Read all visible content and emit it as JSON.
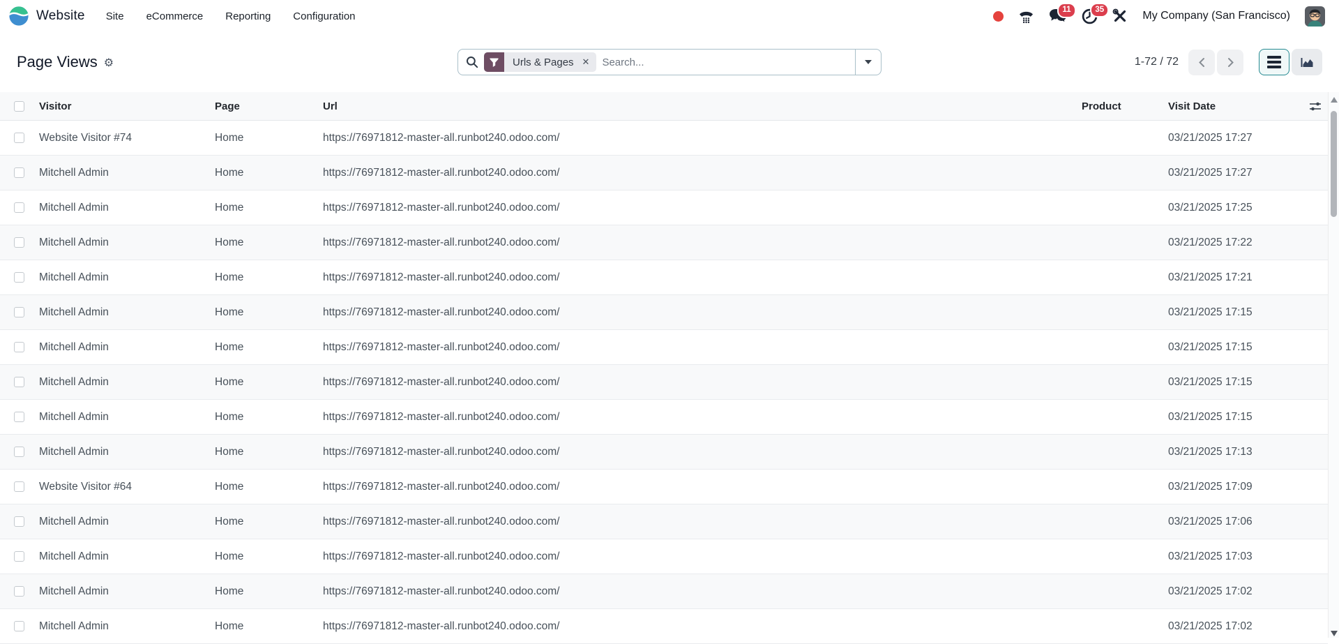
{
  "navbar": {
    "app_name": "Website",
    "menu_items": [
      "Site",
      "eCommerce",
      "Reporting",
      "Configuration"
    ],
    "message_badge": "11",
    "activity_badge": "35",
    "company": "My Company (San Francisco)"
  },
  "control_panel": {
    "title": "Page Views",
    "search": {
      "facet_label": "Urls & Pages",
      "placeholder": "Search..."
    },
    "pager": {
      "value": "1-72 / 72"
    }
  },
  "table": {
    "columns": [
      "Visitor",
      "Page",
      "Url",
      "Product",
      "Visit Date"
    ],
    "rows": [
      {
        "visitor": "Website Visitor #74",
        "page": "Home",
        "url": "https://76971812-master-all.runbot240.odoo.com/",
        "product": "",
        "visit_date": "03/21/2025 17:27"
      },
      {
        "visitor": "Mitchell Admin",
        "page": "Home",
        "url": "https://76971812-master-all.runbot240.odoo.com/",
        "product": "",
        "visit_date": "03/21/2025 17:27"
      },
      {
        "visitor": "Mitchell Admin",
        "page": "Home",
        "url": "https://76971812-master-all.runbot240.odoo.com/",
        "product": "",
        "visit_date": "03/21/2025 17:25"
      },
      {
        "visitor": "Mitchell Admin",
        "page": "Home",
        "url": "https://76971812-master-all.runbot240.odoo.com/",
        "product": "",
        "visit_date": "03/21/2025 17:22"
      },
      {
        "visitor": "Mitchell Admin",
        "page": "Home",
        "url": "https://76971812-master-all.runbot240.odoo.com/",
        "product": "",
        "visit_date": "03/21/2025 17:21"
      },
      {
        "visitor": "Mitchell Admin",
        "page": "Home",
        "url": "https://76971812-master-all.runbot240.odoo.com/",
        "product": "",
        "visit_date": "03/21/2025 17:15"
      },
      {
        "visitor": "Mitchell Admin",
        "page": "Home",
        "url": "https://76971812-master-all.runbot240.odoo.com/",
        "product": "",
        "visit_date": "03/21/2025 17:15"
      },
      {
        "visitor": "Mitchell Admin",
        "page": "Home",
        "url": "https://76971812-master-all.runbot240.odoo.com/",
        "product": "",
        "visit_date": "03/21/2025 17:15"
      },
      {
        "visitor": "Mitchell Admin",
        "page": "Home",
        "url": "https://76971812-master-all.runbot240.odoo.com/",
        "product": "",
        "visit_date": "03/21/2025 17:15"
      },
      {
        "visitor": "Mitchell Admin",
        "page": "Home",
        "url": "https://76971812-master-all.runbot240.odoo.com/",
        "product": "",
        "visit_date": "03/21/2025 17:13"
      },
      {
        "visitor": "Website Visitor #64",
        "page": "Home",
        "url": "https://76971812-master-all.runbot240.odoo.com/",
        "product": "",
        "visit_date": "03/21/2025 17:09"
      },
      {
        "visitor": "Mitchell Admin",
        "page": "Home",
        "url": "https://76971812-master-all.runbot240.odoo.com/",
        "product": "",
        "visit_date": "03/21/2025 17:06"
      },
      {
        "visitor": "Mitchell Admin",
        "page": "Home",
        "url": "https://76971812-master-all.runbot240.odoo.com/",
        "product": "",
        "visit_date": "03/21/2025 17:03"
      },
      {
        "visitor": "Mitchell Admin",
        "page": "Home",
        "url": "https://76971812-master-all.runbot240.odoo.com/",
        "product": "",
        "visit_date": "03/21/2025 17:02"
      },
      {
        "visitor": "Mitchell Admin",
        "page": "Home",
        "url": "https://76971812-master-all.runbot240.odoo.com/",
        "product": "",
        "visit_date": "03/21/2025 17:02"
      }
    ]
  },
  "icons": {
    "close": "✕",
    "gear": "⚙",
    "record_dot": "red-circle",
    "phone": "phone-handset-dialpad",
    "messages": "chat-bubbles",
    "activities": "clock",
    "tools": "crossed-tools",
    "search": "magnifier",
    "filter": "funnel",
    "list_view": "list-bars",
    "graph_view": "area-chart",
    "column_settings": "sliders"
  },
  "colors": {
    "accent_purple": "#6E4D63",
    "active_teal": "#268A91",
    "badge_red": "#DB3E4D",
    "stripe": "#F8F9FA",
    "logo_teal": "#36C18F",
    "logo_blue": "#3E8ED0"
  }
}
